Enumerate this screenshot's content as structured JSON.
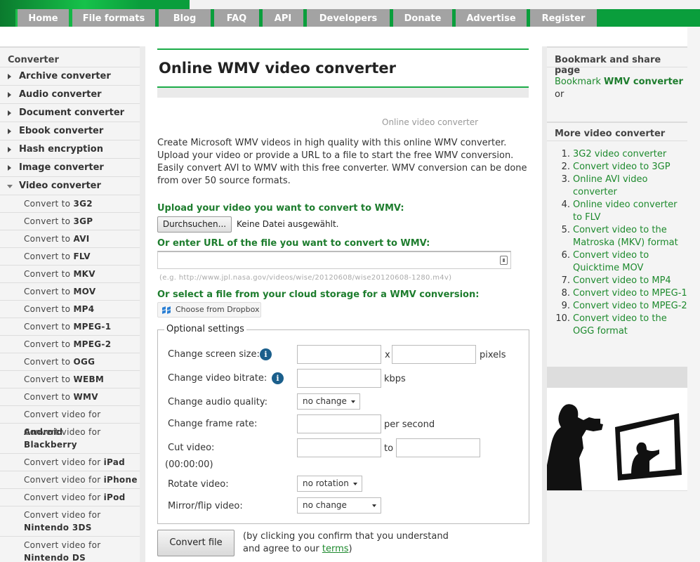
{
  "nav": [
    "Home",
    "File formats",
    "Blog",
    "FAQ",
    "API",
    "Developers",
    "Donate",
    "Advertise",
    "Register"
  ],
  "sidebar": {
    "heading": "Converter",
    "categories": [
      "Archive converter",
      "Audio converter",
      "Document converter",
      "Ebook converter",
      "Hash encryption",
      "Image converter",
      "Video converter"
    ],
    "items": [
      {
        "prefix": "Convert to ",
        "bold": "3G2"
      },
      {
        "prefix": "Convert to ",
        "bold": "3GP"
      },
      {
        "prefix": "Convert to ",
        "bold": "AVI"
      },
      {
        "prefix": "Convert to ",
        "bold": "FLV"
      },
      {
        "prefix": "Convert to ",
        "bold": "MKV"
      },
      {
        "prefix": "Convert to ",
        "bold": "MOV"
      },
      {
        "prefix": "Convert to ",
        "bold": "MP4"
      },
      {
        "prefix": "Convert to ",
        "bold": "MPEG-1"
      },
      {
        "prefix": "Convert to ",
        "bold": "MPEG-2"
      },
      {
        "prefix": "Convert to ",
        "bold": "OGG"
      },
      {
        "prefix": "Convert to ",
        "bold": "WEBM"
      },
      {
        "prefix": "Convert to ",
        "bold": "WMV"
      },
      {
        "prefix": "Convert video for ",
        "bold": "Android"
      },
      {
        "prefix": "Convert video for ",
        "bold": "Blackberry"
      },
      {
        "prefix": "Convert video for ",
        "bold": "iPad"
      },
      {
        "prefix": "Convert video for ",
        "bold": "iPhone"
      },
      {
        "prefix": "Convert video for ",
        "bold": "iPod"
      },
      {
        "prefix": "Convert video for ",
        "bold": "Nintendo 3DS"
      },
      {
        "prefix": "Convert video for ",
        "bold": "Nintendo DS"
      }
    ]
  },
  "main": {
    "title": "Online WMV video converter",
    "sub_heading": "Online video converter",
    "intro": "Create Microsoft WMV videos in high quality with this online WMV converter. Upload your video or provide a URL to a file to start the free WMV conversion. Easily convert AVI to WMV with this free converter. WMV conversion can be done from over 50 source formats.",
    "upload_label": "Upload your video you want to convert to WMV:",
    "file_button": "Durchsuchen...",
    "file_status": "Keine Datei ausgewählt.",
    "url_label": "Or enter URL of the file you want to convert to WMV:",
    "url_value": "",
    "url_hint": "(e.g. http://www.jpl.nasa.gov/videos/wise/20120608/wise20120608-1280.m4v)",
    "cloud_label": "Or select a file from your cloud storage for a WMV conversion:",
    "dropbox_button": "Choose from Dropbox",
    "settings": {
      "legend": "Optional settings",
      "screen_size": "Change screen size:",
      "x": "x",
      "pixels": "pixels",
      "bitrate": "Change video bitrate:",
      "kbps": "kbps",
      "audio_quality": "Change audio quality:",
      "audio_quality_value": "no change",
      "frame_rate": "Change frame rate:",
      "per_second": "per second",
      "cut_video": "Cut video:",
      "cut_format": "(00:00:00)",
      "to": "to",
      "rotate": "Rotate video:",
      "rotate_value": "no rotation",
      "mirror": "Mirror/flip video:",
      "mirror_value": "no change"
    },
    "convert_button": "Convert file",
    "confirm_text": "(by clicking you confirm that you understand and agree to our ",
    "terms": "terms",
    "confirm_end": ")"
  },
  "right": {
    "bookmark_heading": "Bookmark and share page",
    "bookmark_prefix": "Bookmark ",
    "bookmark_bold": "WMV converter",
    "bookmark_or": "or",
    "more_heading": "More video converter",
    "more_items": [
      "3G2 video converter",
      "Convert video to 3GP",
      "Online AVI video converter",
      "Online video converter to FLV",
      "Convert video to the Matroska (MKV) format",
      "Convert video to Quicktime MOV",
      "Convert video to MP4",
      "Convert video to MPEG-1",
      "Convert video to MPEG-2",
      "Convert video to the OGG format"
    ]
  },
  "colors": {
    "brand_green": "#0a9e3c",
    "link_green": "#1e8a2e",
    "nav_gray": "#a3a3a3"
  }
}
